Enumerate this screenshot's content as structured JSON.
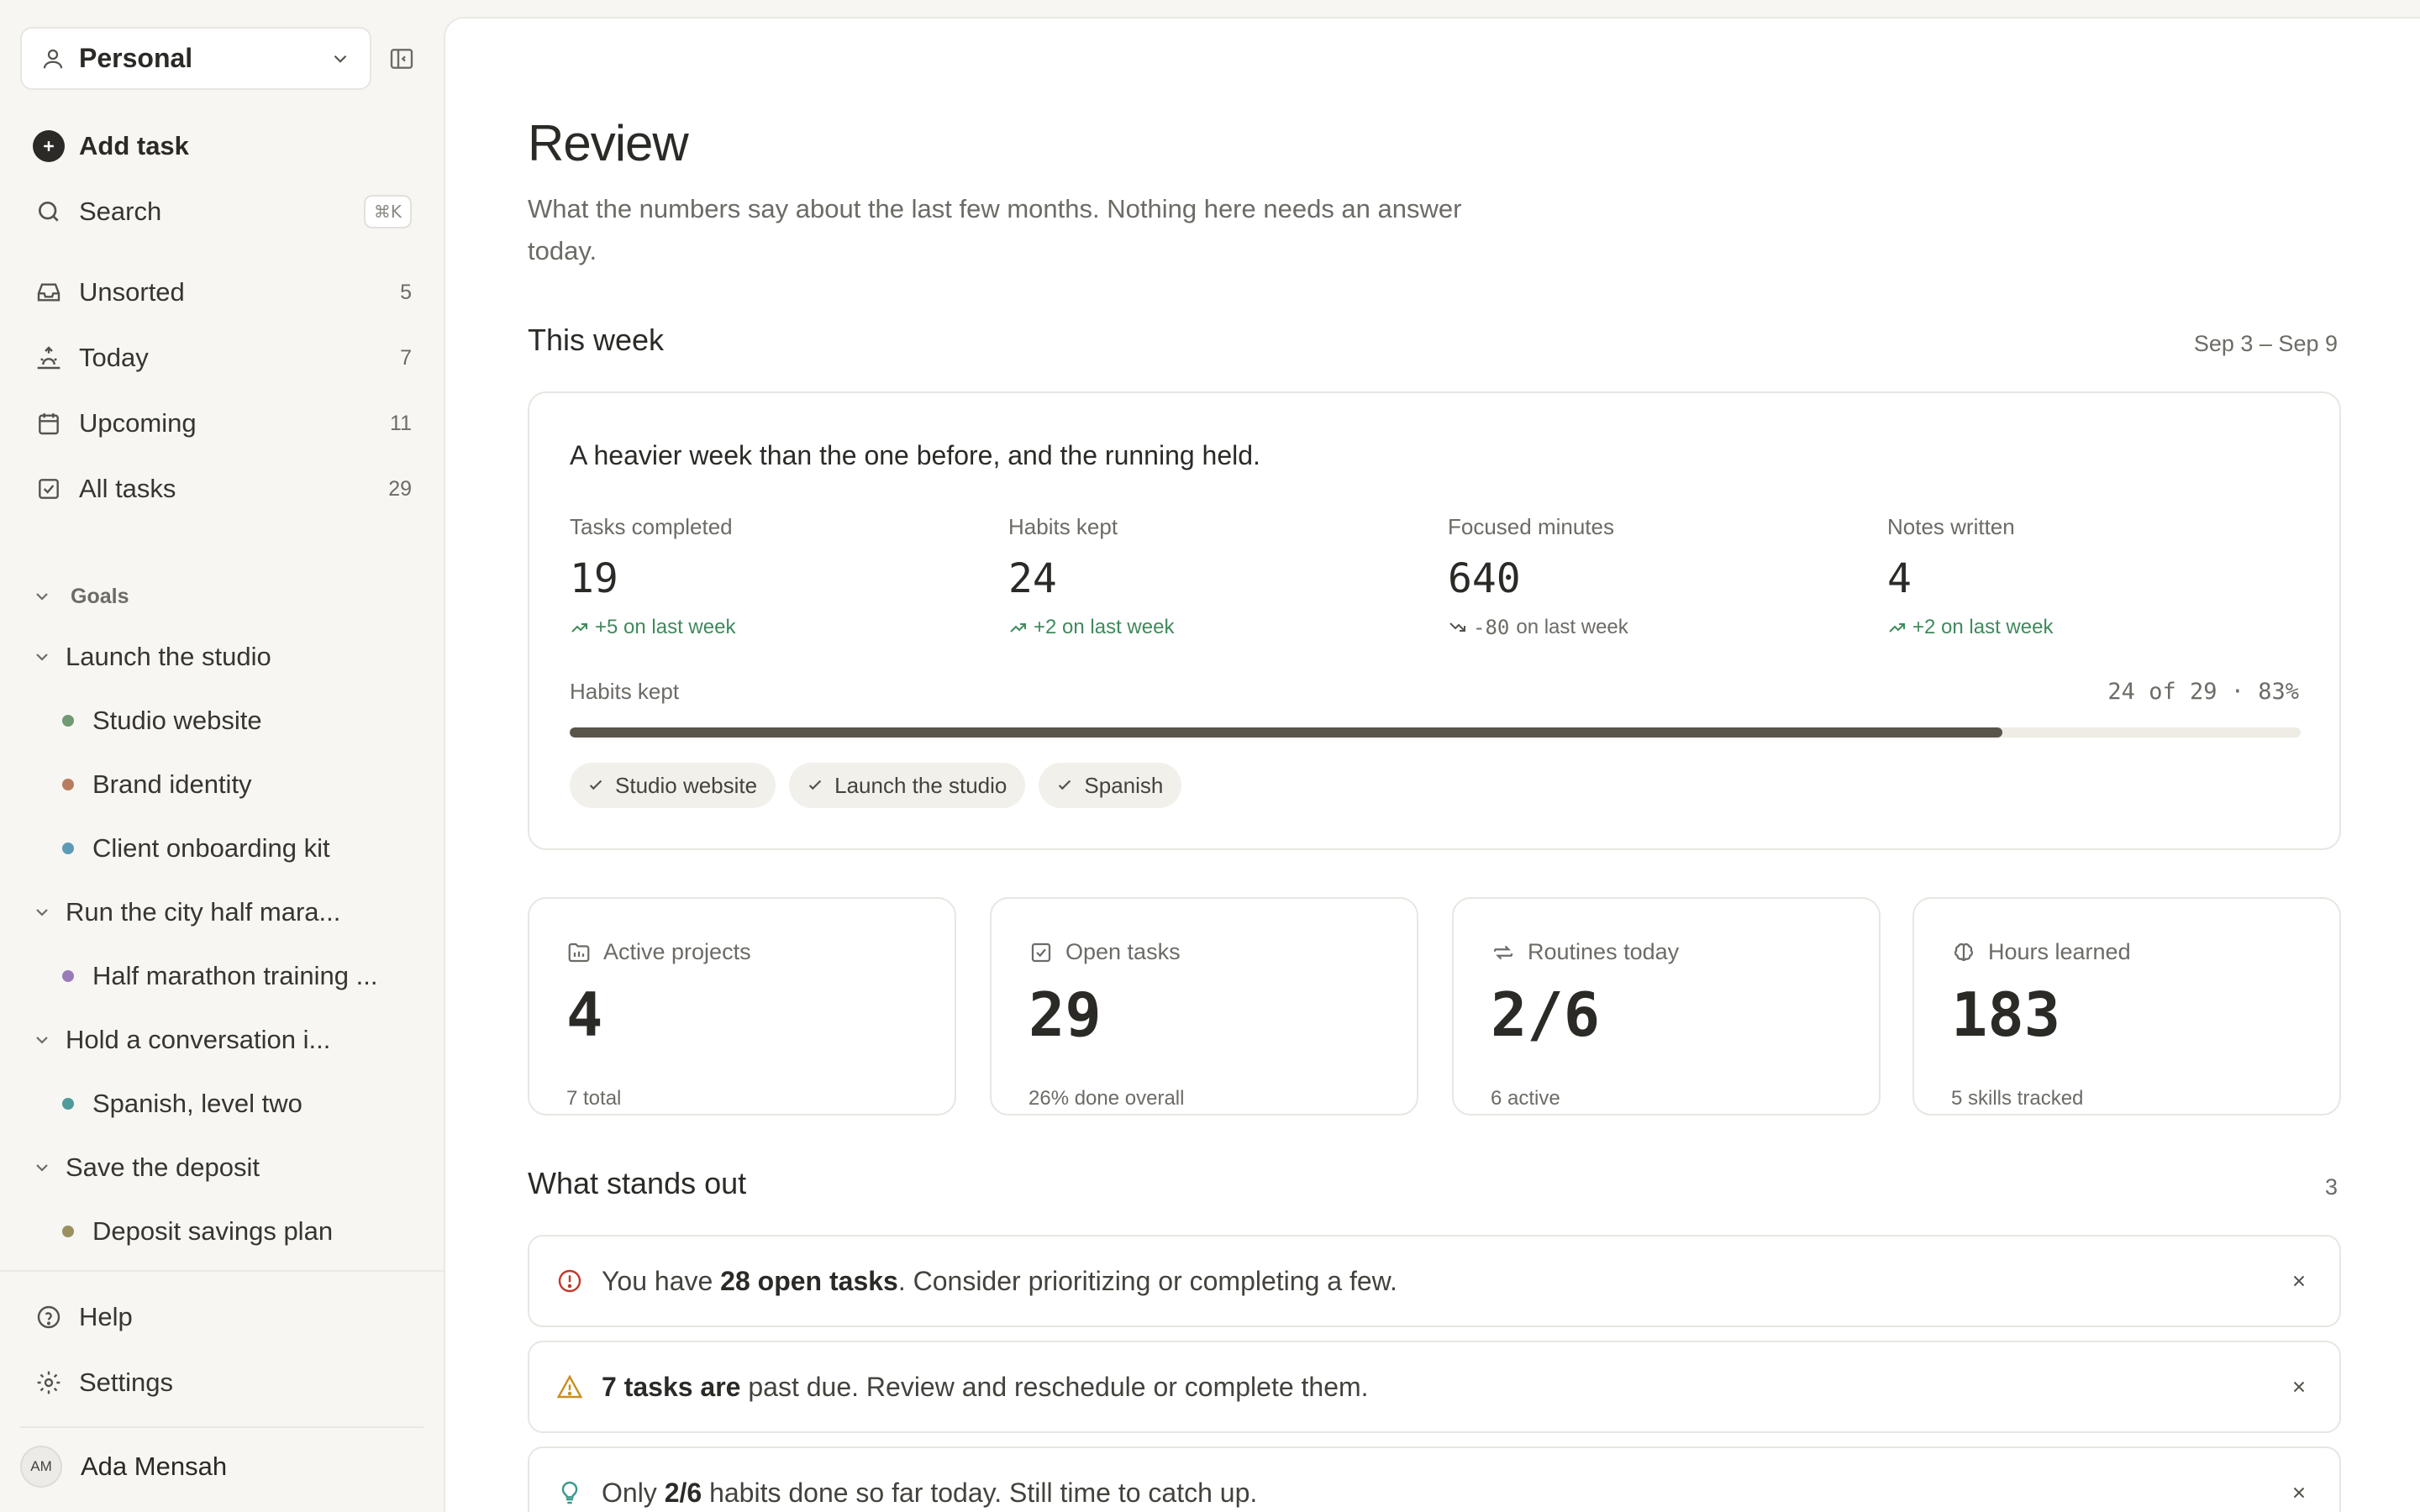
{
  "sidebar": {
    "workspace": "Personal",
    "add_task": "Add task",
    "search": {
      "label": "Search",
      "shortcut": "⌘K"
    },
    "nav": [
      {
        "label": "Unsorted",
        "count": "5"
      },
      {
        "label": "Today",
        "count": "7"
      },
      {
        "label": "Upcoming",
        "count": "11"
      },
      {
        "label": "All tasks",
        "count": "29"
      }
    ],
    "goals_title": "Goals",
    "goals": [
      {
        "label": "Launch the studio",
        "projects": [
          {
            "label": "Studio website",
            "color": "#6f9a72"
          },
          {
            "label": "Brand identity",
            "color": "#b87d5e"
          },
          {
            "label": "Client onboarding kit",
            "color": "#5b9bb5"
          }
        ]
      },
      {
        "label": "Run the city half mara...",
        "projects": [
          {
            "label": "Half marathon training ...",
            "color": "#9a7bb8"
          }
        ]
      },
      {
        "label": "Hold a conversation i...",
        "projects": [
          {
            "label": "Spanish, level two",
            "color": "#4f9a9a"
          }
        ]
      },
      {
        "label": "Save the deposit",
        "projects": [
          {
            "label": "Deposit savings plan",
            "color": "#9a9060"
          }
        ]
      }
    ],
    "help": "Help",
    "settings": "Settings",
    "user": {
      "initials": "AM",
      "name": "Ada Mensah"
    }
  },
  "main": {
    "title": "Review",
    "subtitle": "What the numbers say about the last few months. Nothing here needs an answer today.",
    "this_week": {
      "title": "This week",
      "range": "Sep 3 – Sep 9",
      "summary": "A heavier week than the one before, and the running held.",
      "stats": [
        {
          "label": "Tasks completed",
          "value": "19",
          "delta": "+5 on last week",
          "trend": "up"
        },
        {
          "label": "Habits kept",
          "value": "24",
          "delta": "+2 on last week",
          "trend": "up"
        },
        {
          "label": "Focused minutes",
          "value": "640",
          "delta_value": "-80",
          "delta_suffix": "on last week",
          "trend": "down"
        },
        {
          "label": "Notes written",
          "value": "4",
          "delta": "+2 on last week",
          "trend": "up"
        }
      ],
      "habits_bar": {
        "label": "Habits kept",
        "meta": "24 of 29 · 83%",
        "kept": 24,
        "total": 29
      },
      "chips": [
        "Studio website",
        "Launch the studio",
        "Spanish"
      ]
    },
    "metrics": [
      {
        "icon": "folder-icon",
        "label": "Active projects",
        "value": "4",
        "sub": "7 total"
      },
      {
        "icon": "checkbox-icon",
        "label": "Open tasks",
        "value": "29",
        "sub": "26% done overall"
      },
      {
        "icon": "repeat-icon",
        "label": "Routines today",
        "value": "2/6",
        "sub": "6 active"
      },
      {
        "icon": "brain-icon",
        "label": "Hours learned",
        "value": "183",
        "sub": "5 skills tracked"
      }
    ],
    "stands_out": {
      "title": "What stands out",
      "count": "3",
      "alerts": [
        {
          "icon": "alert-circle-icon",
          "pre": "You have ",
          "bold": "28 open tasks",
          "post": ". Consider prioritizing or completing a few."
        },
        {
          "icon": "warning-triangle-icon",
          "pre": "",
          "bold": "7 tasks are",
          "post": " past due. Review and reschedule or complete them."
        },
        {
          "icon": "lightbulb-icon",
          "pre": "Only ",
          "bold": "2/6",
          "post": " habits done so far today. Still time to catch up."
        }
      ]
    }
  },
  "colors": {
    "accent_dark": "#2b2a27",
    "positive": "#3f8a5c",
    "alert_red": "#c0392b",
    "warning_amber": "#c8901e",
    "hint_teal": "#3a9a8a"
  }
}
